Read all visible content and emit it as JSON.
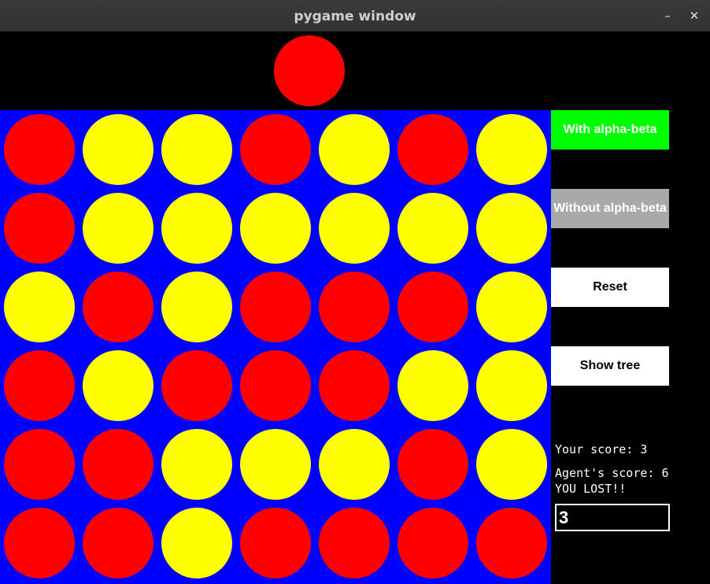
{
  "window": {
    "title": "pygame window",
    "minimize_glyph": "–",
    "close_glyph": "✕"
  },
  "colors": {
    "board": "#0000ff",
    "red": "#ff0000",
    "yellow": "#ffff00",
    "background": "#000000"
  },
  "drop_piece": {
    "color": "red",
    "column": 3
  },
  "board": {
    "rows": 6,
    "cols": 7,
    "cells": [
      [
        "R",
        "Y",
        "Y",
        "R",
        "Y",
        "R",
        "Y"
      ],
      [
        "R",
        "Y",
        "Y",
        "Y",
        "Y",
        "Y",
        "Y"
      ],
      [
        "Y",
        "R",
        "Y",
        "R",
        "R",
        "R",
        "Y"
      ],
      [
        "R",
        "Y",
        "R",
        "R",
        "R",
        "Y",
        "Y"
      ],
      [
        "R",
        "R",
        "Y",
        "Y",
        "Y",
        "R",
        "Y"
      ],
      [
        "R",
        "R",
        "Y",
        "R",
        "R",
        "R",
        "R"
      ]
    ]
  },
  "buttons": {
    "alpha_beta": {
      "label": "With alpha-beta",
      "bg": "#00ff00"
    },
    "no_alpha_beta": {
      "label": "Without alpha-beta",
      "bg": "#a9a9a9"
    },
    "reset": {
      "label": "Reset",
      "bg": "#ffffff"
    },
    "show_tree": {
      "label": "Show tree",
      "bg": "#ffffff"
    }
  },
  "status": {
    "your_score": "Your score: 3",
    "agent_score": "Agent's score: 6",
    "result": "YOU LOST!!"
  },
  "depth_input": {
    "value": "3"
  }
}
